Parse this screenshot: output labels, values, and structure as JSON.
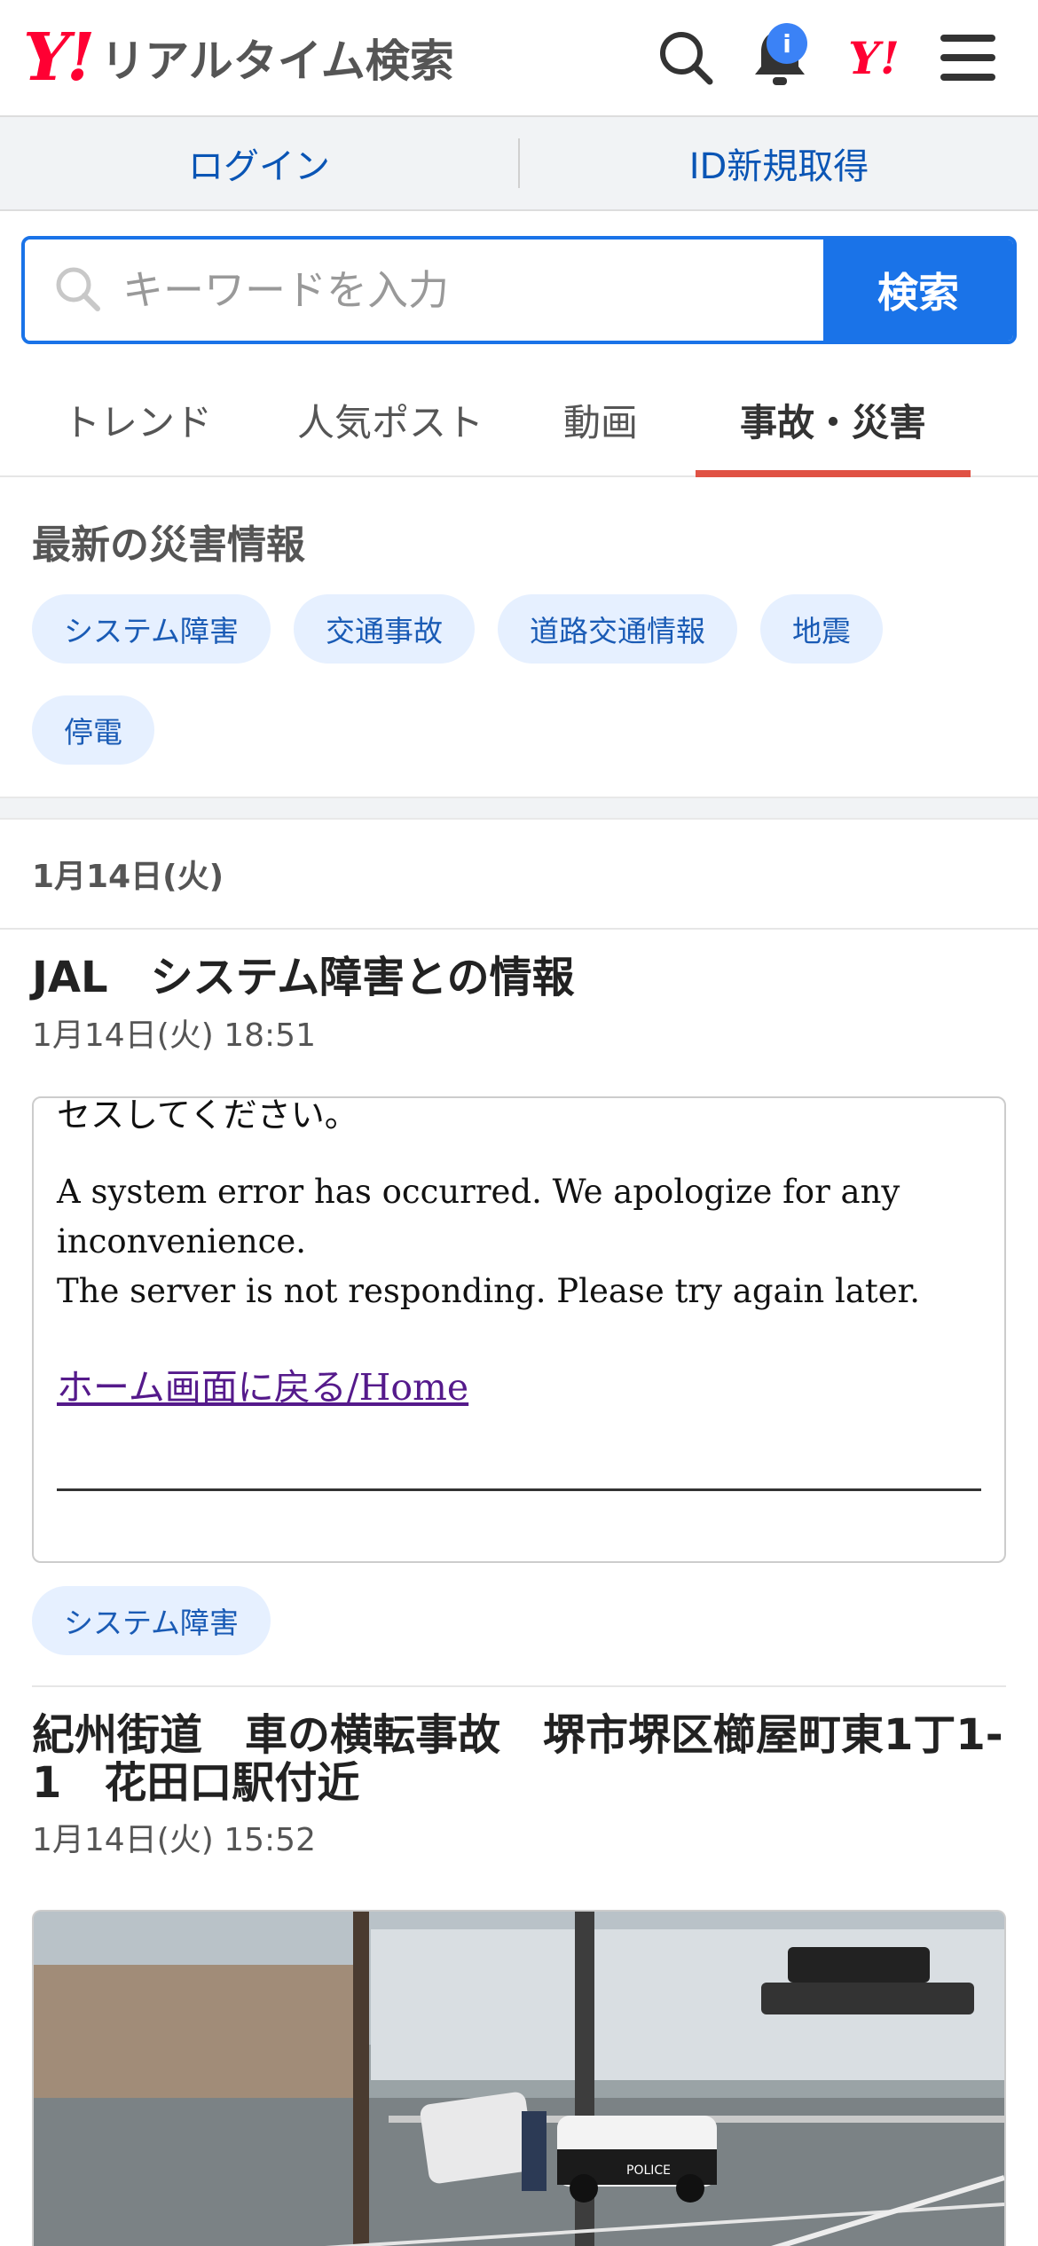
{
  "header": {
    "logo_mark": "Y!",
    "title": "リアルタイム検索",
    "badge": "i",
    "yj_mark": "Y!"
  },
  "login": {
    "login_label": "ログイン",
    "register_label": "ID新規取得"
  },
  "search": {
    "placeholder": "キーワードを入力",
    "button_label": "検索"
  },
  "tabs": [
    {
      "label": "トレンド"
    },
    {
      "label": "人気ポスト"
    },
    {
      "label": "動画"
    },
    {
      "label": "事故・災害",
      "active": true
    }
  ],
  "disaster": {
    "title": "最新の災害情報",
    "chips": [
      "システム障害",
      "交通事故",
      "道路交通情報",
      "地震",
      "停電"
    ]
  },
  "date_header": "1月14日(火)",
  "posts": [
    {
      "title": "JAL　システム障害との情報",
      "time": "1月14日(火) 18:51",
      "screenshot": {
        "cut_line": "セスしてください。",
        "line1": "A system error has occurred. We apologize for any inconvenience.",
        "line2": "The server is not responding. Please try again later.",
        "link": "ホーム画面に戻る/Home"
      },
      "tag": "システム障害"
    },
    {
      "title": "紀州街道　車の横転事故　堺市堺区櫛屋町東1丁1-1　花田口駅付近",
      "time": "1月14日(火) 15:52",
      "photo_text": "POLICE"
    }
  ],
  "colors": {
    "accent": "#1a73e8",
    "brand_red": "#ff0033",
    "tab_underline": "#e05244",
    "chip_bg": "#e6f0ff"
  }
}
